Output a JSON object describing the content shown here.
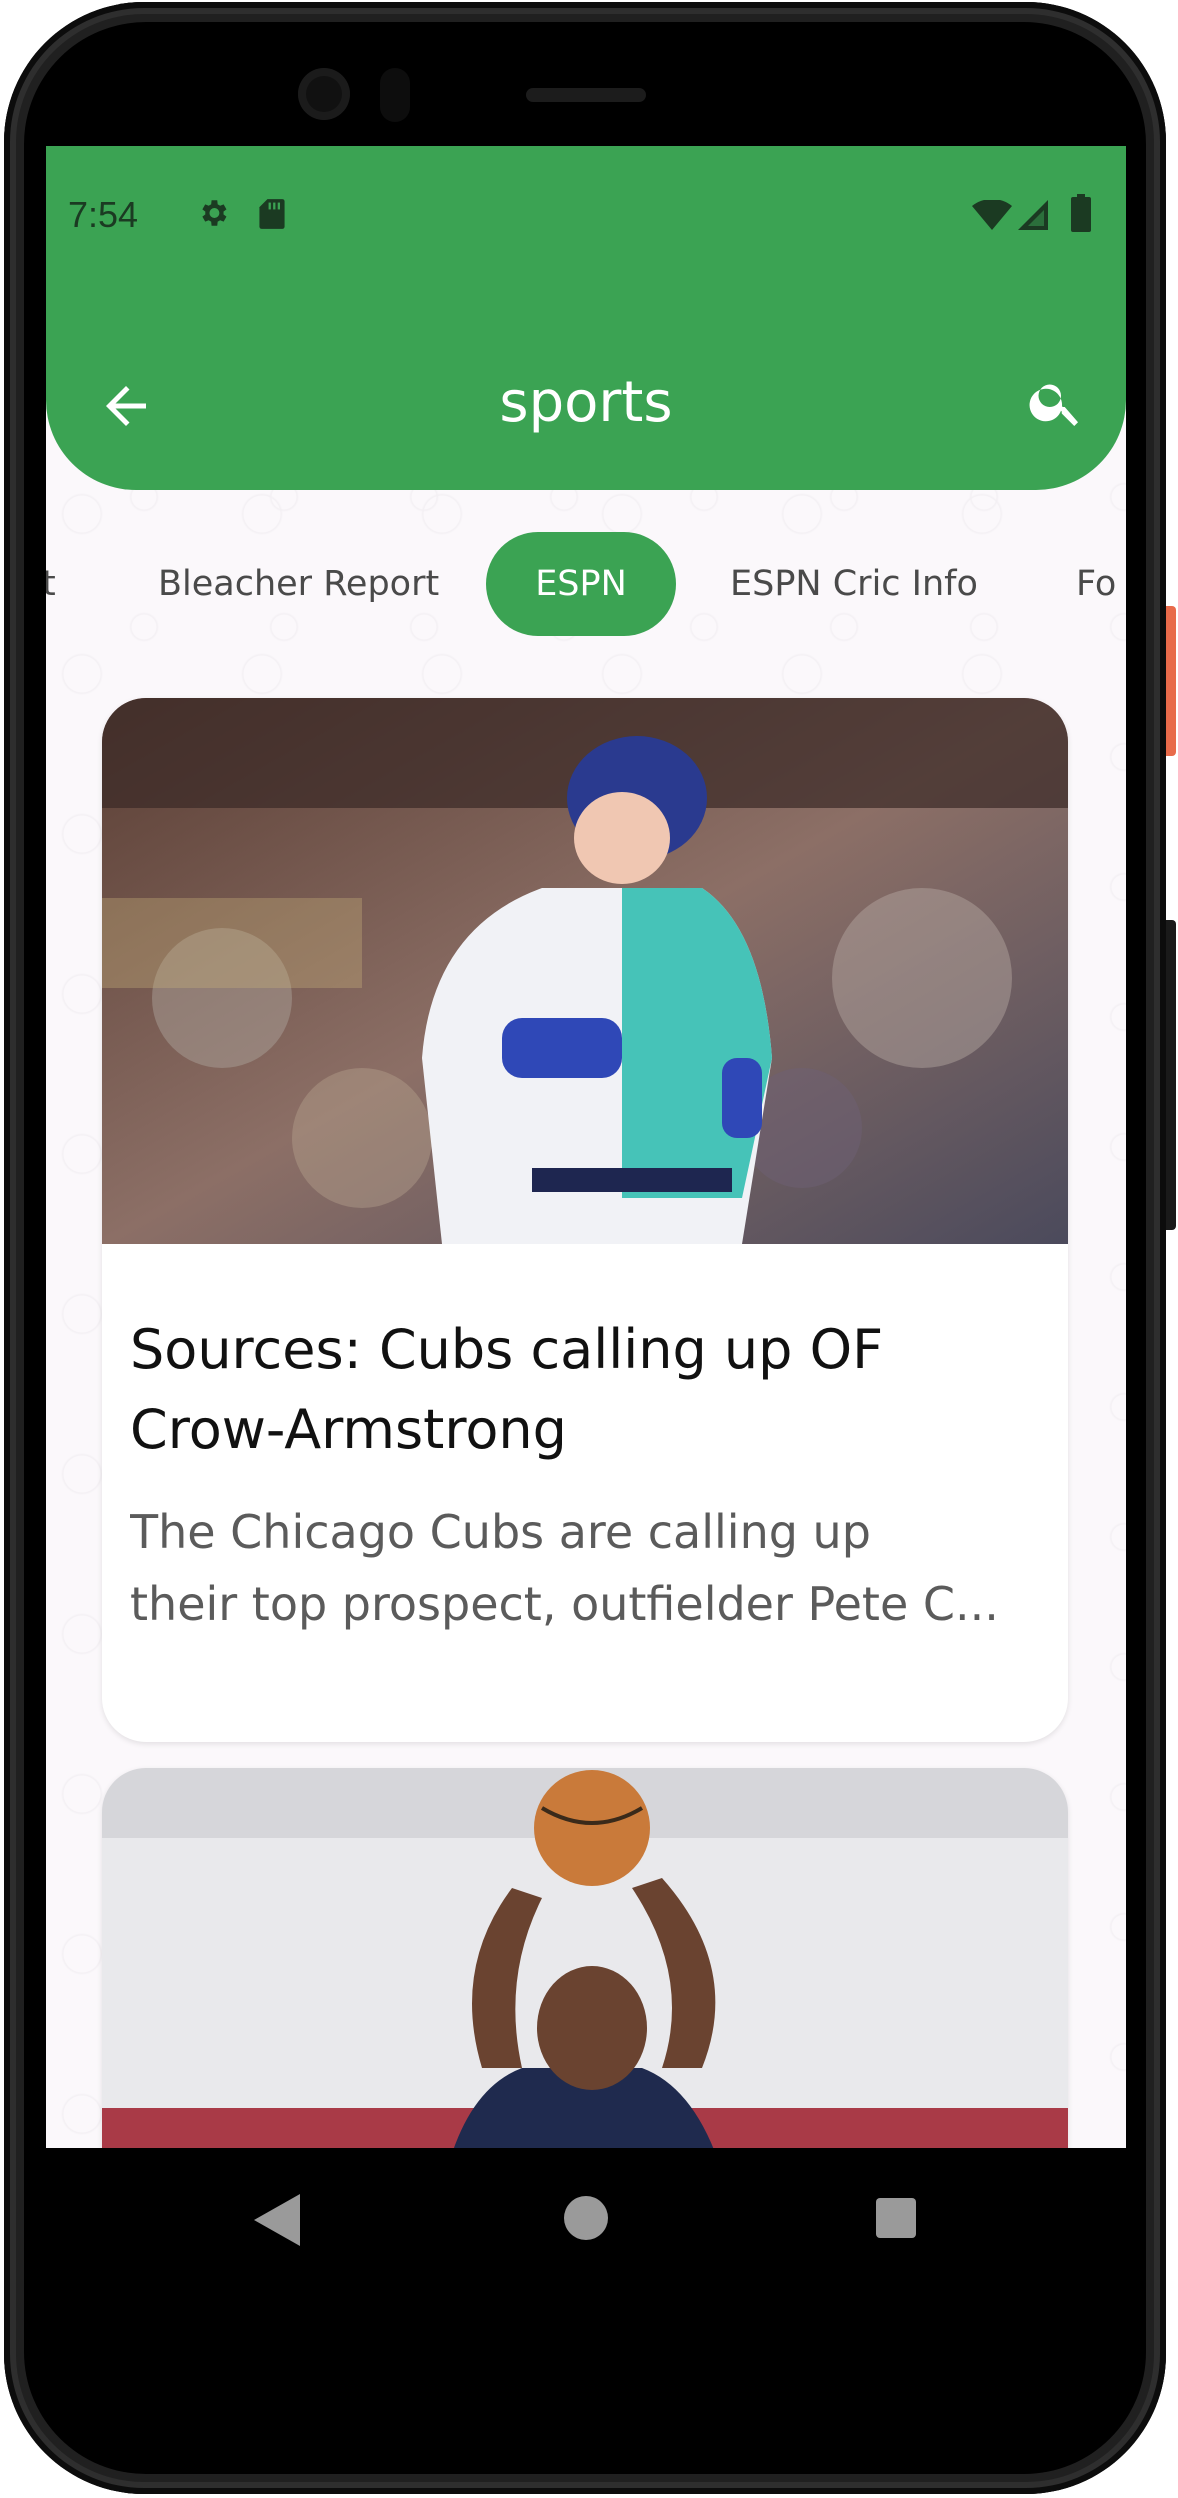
{
  "status_bar": {
    "time": "7:54"
  },
  "app_bar": {
    "title": "sports"
  },
  "tabs": [
    {
      "label": "t"
    },
    {
      "label": "Bleacher Report"
    },
    {
      "label": "ESPN"
    },
    {
      "label": "ESPN Cric Info"
    },
    {
      "label": "Fo"
    }
  ],
  "active_tab_index": 2,
  "articles": [
    {
      "title": "Sources: Cubs calling up OF Crow-Armstrong",
      "description_line1": "The Chicago Cubs are calling up",
      "description_line2": "their top prospect, outfielder Pete C...",
      "image": "baseball-player-photo"
    },
    {
      "title": "",
      "description_line1": "",
      "description_line2": "",
      "image": "basketball-player-photo"
    }
  ],
  "colors": {
    "accent": "#3ba353",
    "background": "#fbf8fb"
  },
  "icons": [
    "gear-icon",
    "sd-card-icon",
    "wifi-icon",
    "signal-icon",
    "battery-icon",
    "back-arrow-icon",
    "search-icon"
  ]
}
